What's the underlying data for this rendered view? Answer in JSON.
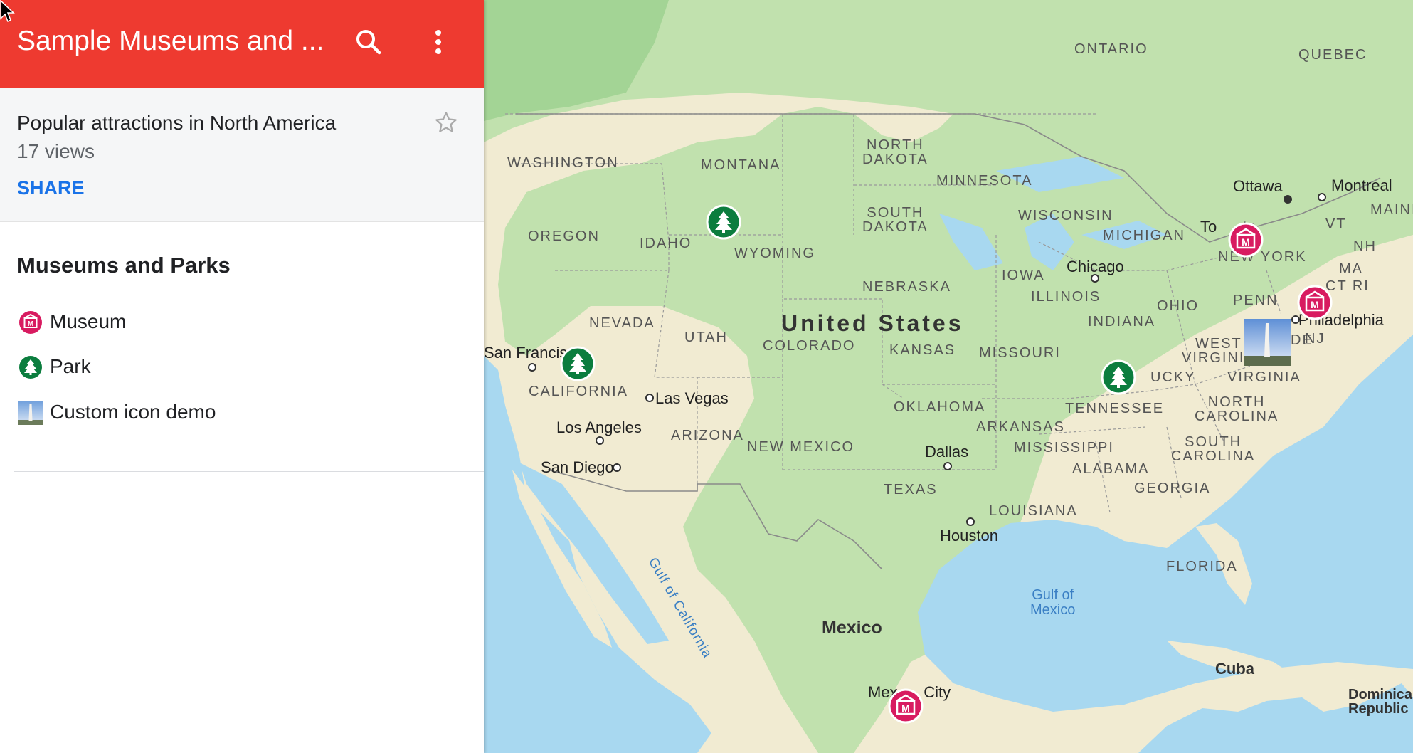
{
  "sidebar": {
    "title": "Sample Museums and ...",
    "description": "Popular attractions in North America",
    "views": "17 views",
    "share_label": "SHARE",
    "layer_title": "Museums and Parks",
    "legend": [
      {
        "label": "Museum",
        "icon": "museum-icon",
        "color": "#d81b60"
      },
      {
        "label": "Park",
        "icon": "tree-icon",
        "color": "#0b7d3e"
      },
      {
        "label": "Custom icon demo",
        "icon": "monument-photo-icon",
        "color": "#9bbde6"
      }
    ]
  },
  "colors": {
    "header": "#ee3a30",
    "share": "#1a73e8",
    "water": "#a8d8f0",
    "land": "#f1ebd2",
    "green": "#b9dfa8"
  },
  "map": {
    "countries": {
      "us": "United States",
      "mexico": "Mexico",
      "cuba": "Cuba",
      "dominican": "Dominica\nRepublic"
    },
    "regions": {
      "ontario": "ONTARIO",
      "quebec": "QUEBEC",
      "washington": "WASHINGTON",
      "montana": "MONTANA",
      "north_dakota": "NORTH\nDAKOTA",
      "minnesota": "MINNESOTA",
      "south_dakota": "SOUTH\nDAKOTA",
      "wisconsin": "WISCONSIN",
      "michigan": "MICHIGAN",
      "oregon": "OREGON",
      "idaho": "IDAHO",
      "wyoming": "WYOMING",
      "iowa": "IOWA",
      "nebraska": "NEBRASKA",
      "illinois": "ILLINOIS",
      "ohio": "OHIO",
      "penn": "PENN",
      "nevada": "NEVADA",
      "utah": "UTAH",
      "colorado": "COLORADO",
      "kansas": "KANSAS",
      "missouri": "MISSOURI",
      "indiana": "INDIANA",
      "west_virginia": "WEST\nVIRGINIA",
      "virginia": "VIRGINIA",
      "kentucky": "UCKY",
      "california": "CALIFORNIA",
      "oklahoma": "OKLAHOMA",
      "arkansas": "ARKANSAS",
      "tennessee": "TENNESSEE",
      "north_carolina": "NORTH\nCAROLINA",
      "arizona": "ARIZONA",
      "new_mexico": "NEW MEXICO",
      "mississippi": "MISSISSIPPI",
      "south_carolina": "SOUTH\nCAROLINA",
      "alabama": "ALABAMA",
      "georgia": "GEORGIA",
      "texas": "TEXAS",
      "louisiana": "LOUISIANA",
      "florida": "FLORIDA",
      "new_york": "NEW YORK",
      "vt": "VT",
      "nh": "NH",
      "ma": "MA",
      "ct_ri": "CT RI",
      "nj": "NJ",
      "de": "DE",
      "maine": "MAINI"
    },
    "water": {
      "gulf_california": "Gulf of California",
      "gulf_mexico": "Gulf of\nMexico"
    },
    "cities": {
      "ottawa": "Ottawa",
      "montreal": "Montreal",
      "toronto": "To      to",
      "chicago": "Chicago",
      "philadelphia": "Philadelphia",
      "san_francisco": "San Francis",
      "las_vegas": "Las Vegas",
      "los_angeles": "Los Angeles",
      "san_diego": "San Diego",
      "dallas": "Dallas",
      "houston": "Houston",
      "mexico_city": "Mex      City"
    }
  }
}
